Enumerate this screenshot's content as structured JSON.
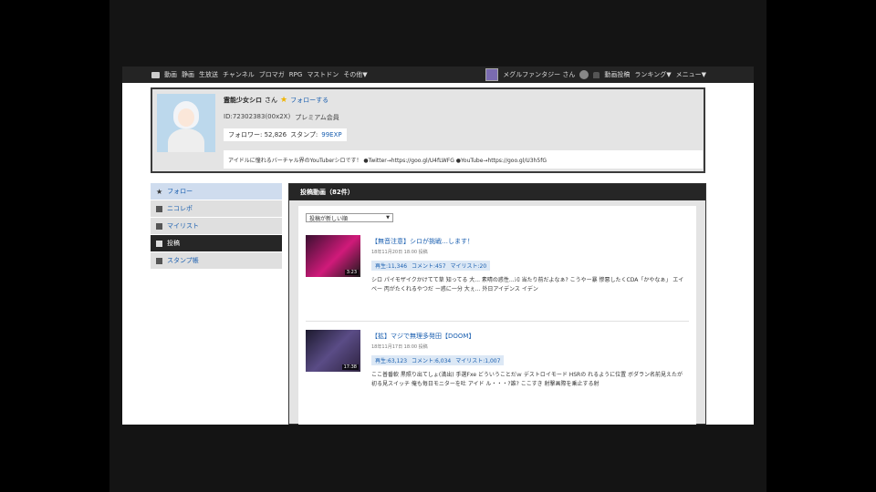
{
  "topbar": {
    "nav": [
      "動画",
      "静画",
      "生放送",
      "チャンネル",
      "ブロマガ",
      "RPG",
      "マストドン",
      "その他▼"
    ],
    "user_label": "メグルファンタジー さん",
    "right_nav": [
      "動画投稿",
      "ランキング▼",
      "メニュー▼"
    ]
  },
  "profile": {
    "name": "霊能少女シロ",
    "honorific": "さん",
    "follow_label": "フォローする",
    "id_text": "ID:72302383(00x2X)",
    "member_type": "プレミアム会員",
    "followers_label": "フォロワー: 52,826",
    "stamp_label": "スタンプ:",
    "stamp_value": "99EXP",
    "description": "アイドルに憧れるバーチャル界のYouTuberシロです！ ●Twitter→https://goo.gl/U4fLWFG ●YouTube→https://goo.gl/U3h5fG"
  },
  "sidebar": {
    "items": [
      {
        "label": "フォロー"
      },
      {
        "label": "ニコレポ"
      },
      {
        "label": "マイリスト"
      },
      {
        "label": "投稿"
      },
      {
        "label": "スタンプ帳"
      }
    ]
  },
  "videos": {
    "header": "投稿動画（82件）",
    "sort_label": "投稿が新しい順",
    "items": [
      {
        "title": "【無音注意】シロが挑戦…します！",
        "date": "18年11月20日 18:00 投稿",
        "duration": "3:23",
        "stats": [
          "再生:11,346",
          "コメント:457",
          "マイリスト:20"
        ],
        "description": "シロ パイモザイクかけてて草 知ってる 大... 素晴の惑性...ｼﾛ 当たり前だよなぁ? こうやー暴 惨悪したくCDA「かやなぁ」 エイベー 丙がたくれるやつだ ー惑に一分 大ぇ... 外日アイデンス イデン"
      },
      {
        "title": "【拡】マジで無理多発田【DOOM】",
        "date": "18年11月17日 18:00 投稿",
        "duration": "17:38",
        "stats": [
          "再生:63,123",
          "コメント:6,034",
          "マイリスト:1,007"
        ],
        "description": "ここ普番軟 黒照り出てしょ(満出) 手選Fxe どういうことだｗ デストロイモード HSRの れるように位置 ボダラン名前見えたが 初る見スイッチ 俺も毎日モニターを吐 アイド ル・・・?誰? ここすき 射撃画際を乗止する射"
      }
    ]
  }
}
